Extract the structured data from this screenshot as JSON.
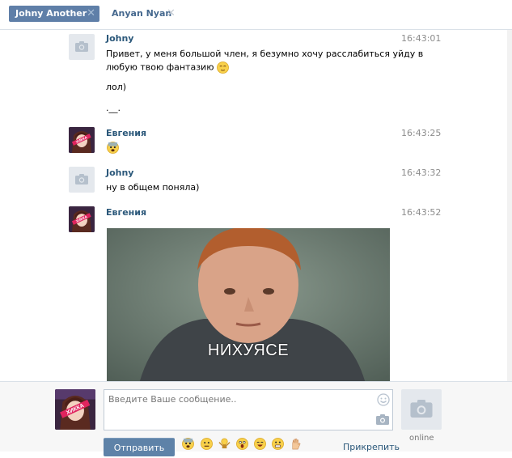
{
  "tabs": [
    {
      "label": "Johny Another",
      "active": true
    },
    {
      "label": "Anyan Nyan",
      "active": false
    }
  ],
  "messages": [
    {
      "author": "Johny",
      "time": "16:43:01",
      "avatar": "camera-placeholder",
      "lines": [
        "Привет, у меня большой член, я безумно хочу расслабиться уйду в",
        "любую твою фантазию",
        "лол)",
        ".__."
      ]
    },
    {
      "author": "Евгения",
      "time": "16:43:25",
      "avatar": "anime-girl"
    },
    {
      "author": "Johny",
      "time": "16:43:32",
      "avatar": "camera-placeholder",
      "lines": [
        "ну в общем поняла)"
      ]
    },
    {
      "author": "Евгения",
      "time": "16:43:52",
      "avatar": "anime-girl",
      "attachment": {
        "type": "gif",
        "caption": "НИХУЯСЕ"
      }
    }
  ],
  "avatar_badge_text": "ХИККА",
  "compose": {
    "placeholder": "Введите Ваше сообщение..",
    "send_label": "Отправить",
    "attach_label": "Прикрепить",
    "status": "online"
  },
  "colors": {
    "accent": "#5f7fa8",
    "author": "#2b587a",
    "time": "#8c8c8c",
    "badge": "#e0245e"
  }
}
